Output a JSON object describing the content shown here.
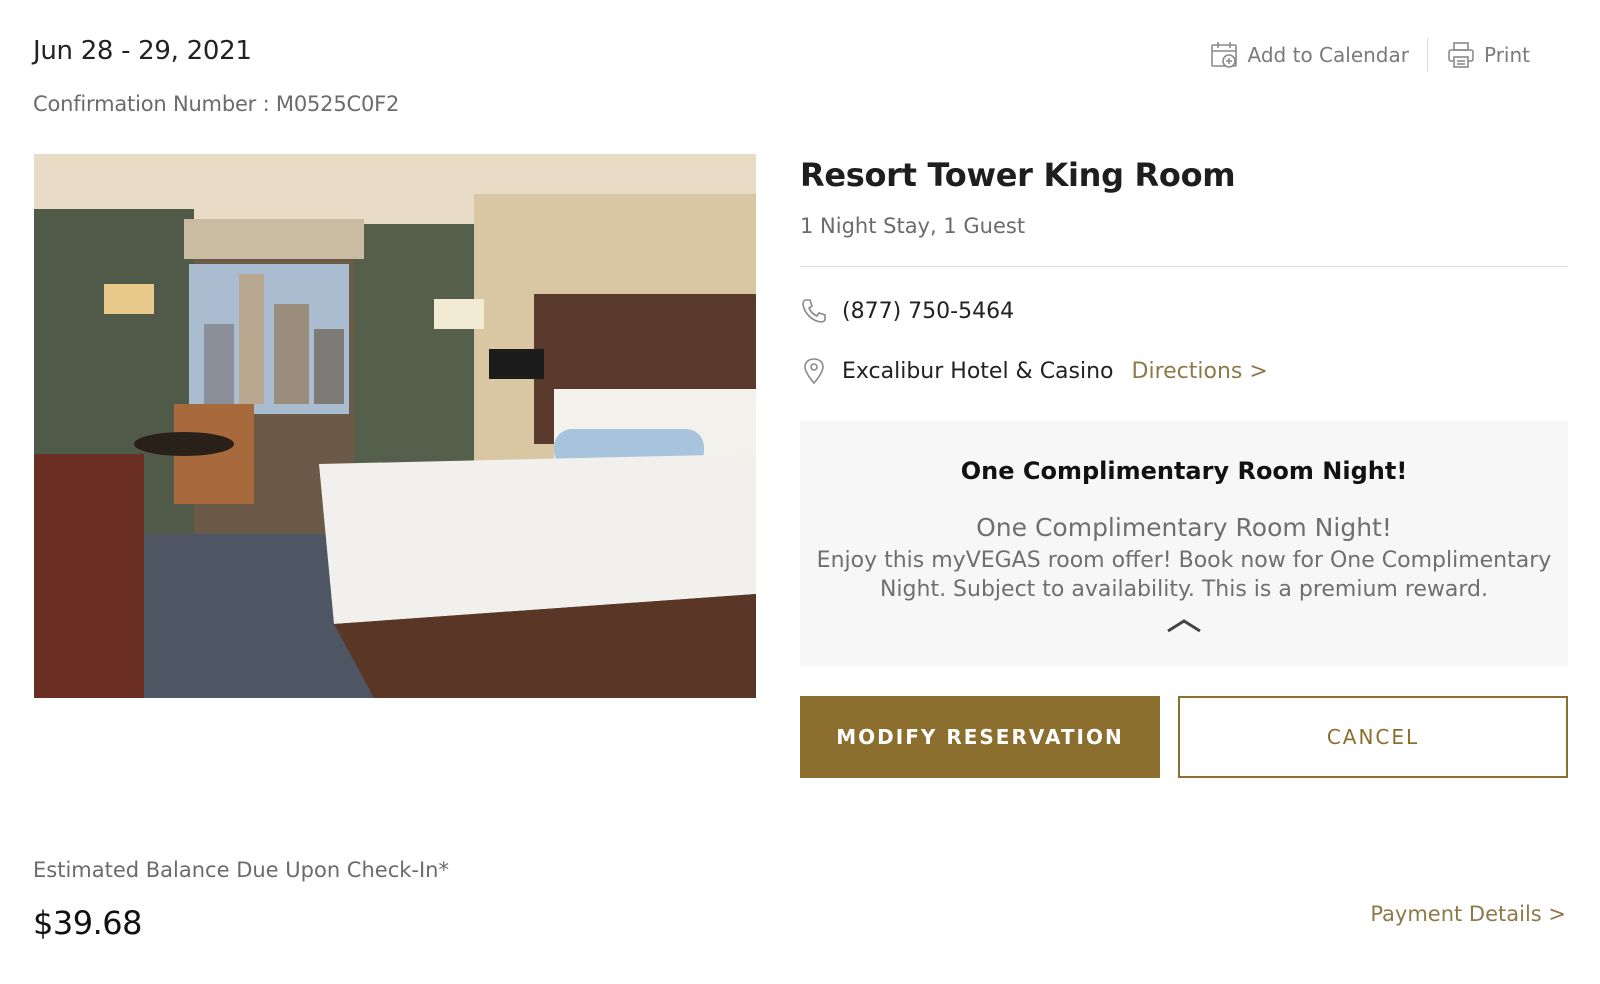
{
  "header": {
    "dates": "Jun 28 - 29, 2021",
    "confirmation": "Confirmation Number : M0525C0F2"
  },
  "actions": {
    "add_to_calendar": "Add to Calendar",
    "print": "Print",
    "add_to_calendar_icon": "calendar-add-icon",
    "print_icon": "printer-icon"
  },
  "photo": {
    "alt": "Hotel room with king bed and city view"
  },
  "room": {
    "title": "Resort Tower King Room",
    "stay": "1 Night Stay, 1 Guest",
    "phone": "(877) 750-5464",
    "phone_icon": "phone-icon",
    "location": "Excalibur Hotel & Casino",
    "location_icon": "map-pin-icon",
    "directions": "Directions >"
  },
  "offer": {
    "title": "One Complimentary Room Night!",
    "subtitle": "One Complimentary Room Night!",
    "description": "Enjoy this myVEGAS room offer! Book now for One Complimentary Night. Subject to availability. This is a premium reward.",
    "collapse_icon": "chevron-up-icon"
  },
  "buttons": {
    "modify": "MODIFY RESERVATION",
    "cancel": "CANCEL"
  },
  "balance": {
    "label": "Estimated Balance Due Upon Check-In*",
    "value": "$39.68",
    "payment_details": "Payment Details >"
  },
  "colors": {
    "brand_gold": "#8c6e2f",
    "link_gold": "#8c7a4a",
    "offer_bg": "#f7f7f7"
  }
}
